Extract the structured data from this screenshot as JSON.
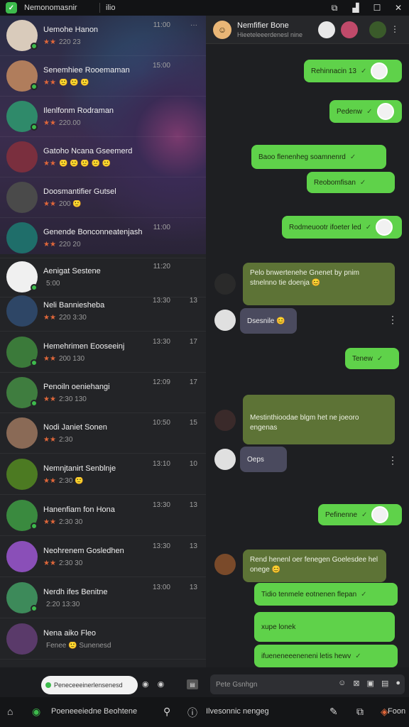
{
  "window": {
    "title": "Nemonomasnir",
    "subtitle": "ilio",
    "controls": {
      "screenshot": "⧉",
      "signal": "▟",
      "maximize": "☐",
      "close": "✕"
    }
  },
  "chat_list": [
    {
      "name": "Uemohe Hanon",
      "preview": "220 23",
      "stars": "★★",
      "time": "11:00",
      "count": "···"
    },
    {
      "name": "Senemhiee Rooemaman",
      "preview": "🙂 🙂 🙂",
      "stars": "★★",
      "time": "15:00",
      "count": ""
    },
    {
      "name": "Ilenlfonm Rodraman",
      "preview": "220.00",
      "stars": "★★",
      "time": "",
      "count": ""
    },
    {
      "name": "Gatoho Ncana Gseemerd",
      "preview": "🙂 🙂 🙂 🙂 🙂",
      "stars": "★★",
      "time": "",
      "count": ""
    },
    {
      "name": "Doosmantifier Gutsel",
      "preview": "200 🙂",
      "stars": "★★",
      "time": "",
      "count": ""
    },
    {
      "name": "Genende Bonconneatenjash",
      "preview": "220 20",
      "stars": "★★",
      "time": "11:00",
      "count": ""
    },
    {
      "name": "Aenigat Sestene",
      "preview": "5:00",
      "stars": "",
      "time": "11:20",
      "count": ""
    },
    {
      "name": "Neli Banniesheba",
      "preview": "220 3:30",
      "stars": "★★",
      "time": "13:30",
      "count": "13"
    },
    {
      "name": "Hemehrimen Eooseeinj",
      "preview": "200 130",
      "stars": "★★",
      "time": "13:30",
      "count": "17"
    },
    {
      "name": "Penoiln oeniehangi",
      "preview": "2:30 130",
      "stars": "★★",
      "time": "12:09",
      "count": "17"
    },
    {
      "name": "Nodi Janiet Sonen",
      "preview": "2:30",
      "stars": "★★",
      "time": "10:50",
      "count": "15"
    },
    {
      "name": "Nemnjtanirt Senblnje",
      "preview": "2:30 🙂",
      "stars": "★★",
      "time": "13:10",
      "count": "10"
    },
    {
      "name": "Hanenfiam fon Hona",
      "preview": "2:30 30",
      "stars": "★★",
      "time": "13:30",
      "count": "13"
    },
    {
      "name": "Neohrenem Gosledhen",
      "preview": "2:30 30",
      "stars": "★★",
      "time": "13:30",
      "count": "13"
    },
    {
      "name": "Nerdh ifes Benitne",
      "preview": "2:20 13:30",
      "stars": "",
      "time": "13:00",
      "count": "13"
    },
    {
      "name": "Nena aiko Fleo",
      "preview": "Fenee 🙂 Sunenesd",
      "stars": "",
      "time": "",
      "count": ""
    }
  ],
  "left_compose": {
    "text": "Peneceeeinerlensenesd"
  },
  "conversation": {
    "contact_name": "Nemfifier Bone",
    "contact_status": "Hieeteleeerdenesl nine",
    "messages_out": [
      {
        "text": "Rehinnacin 13"
      },
      {
        "text": "Pedenw"
      },
      {
        "text": "Baoo flenenheg soamnenrd"
      },
      {
        "text": "Reobomfisan"
      },
      {
        "text": "Rodmeuootr ifoeter led"
      },
      {
        "text": "Tenew"
      },
      {
        "text": "Pefinenne"
      },
      {
        "text": "Tidio tenmele eotnenen flepan"
      },
      {
        "text": "xupe lonek"
      },
      {
        "text": "ifueneneeeneneni letis hewv"
      }
    ],
    "messages_in": [
      {
        "text": "Pelo bnwertenehe Gnenet by pnim stnelnno tie doenja 😊"
      },
      {
        "text": "Dsesnile 😊"
      },
      {
        "text": "Mestinthioodae blgm het ne joeoro engenas"
      },
      {
        "text": "Oeps"
      },
      {
        "text": "Rend henenl oer fenegen Goelesdee hel onege 😊"
      }
    ]
  },
  "composer": {
    "placeholder": "Pete Gsnhgn"
  },
  "bottom_bar": {
    "left_label": "Poeneeeiedne Beohtene",
    "mid_label": "Ilvesonnic nengeg",
    "right_label": "Foon"
  }
}
